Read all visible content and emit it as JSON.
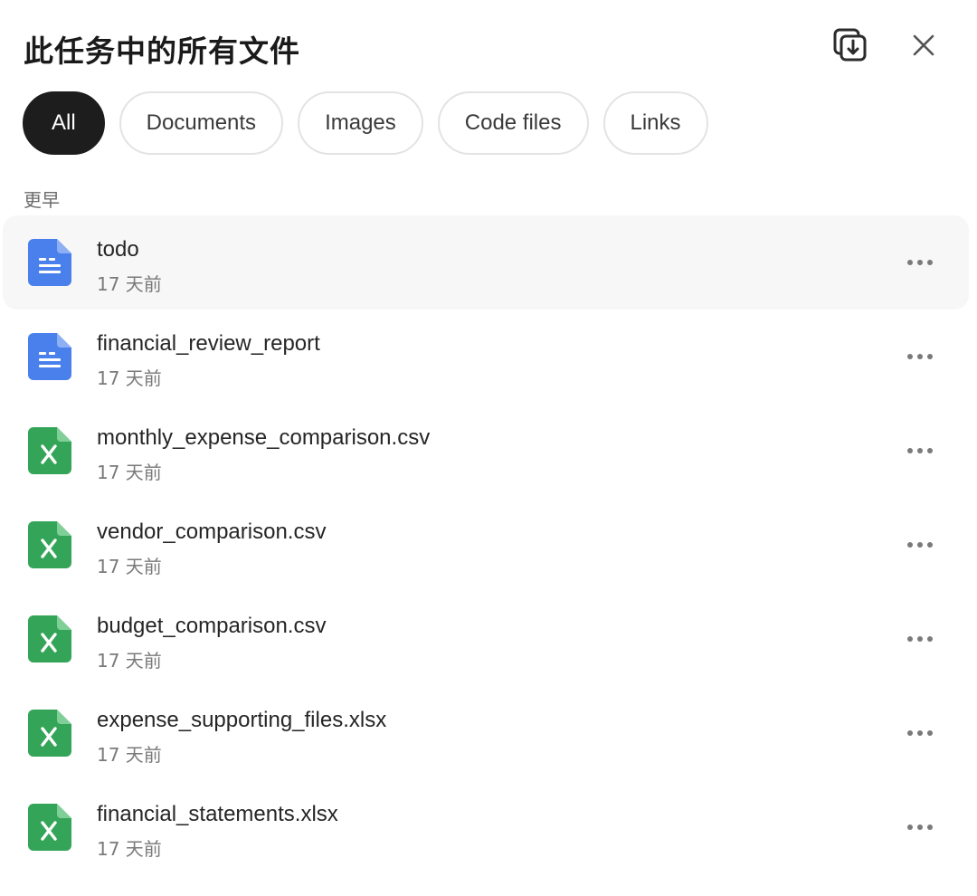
{
  "header": {
    "title": "此任务中的所有文件",
    "download_icon": "download-all-icon",
    "close_icon": "close-icon"
  },
  "tabs": [
    {
      "label": "All",
      "active": true
    },
    {
      "label": "Documents",
      "active": false
    },
    {
      "label": "Images",
      "active": false
    },
    {
      "label": "Code files",
      "active": false
    },
    {
      "label": "Links",
      "active": false
    }
  ],
  "section": {
    "label": "更早"
  },
  "files": [
    {
      "name": "todo",
      "time": "17 天前",
      "type": "doc",
      "icon": "doc-icon"
    },
    {
      "name": "financial_review_report",
      "time": "17 天前",
      "type": "doc",
      "icon": "doc-icon"
    },
    {
      "name": "monthly_expense_comparison.csv",
      "time": "17 天前",
      "type": "sheet",
      "icon": "spreadsheet-icon"
    },
    {
      "name": "vendor_comparison.csv",
      "time": "17 天前",
      "type": "sheet",
      "icon": "spreadsheet-icon"
    },
    {
      "name": "budget_comparison.csv",
      "time": "17 天前",
      "type": "sheet",
      "icon": "spreadsheet-icon"
    },
    {
      "name": "expense_supporting_files.xlsx",
      "time": "17 天前",
      "type": "sheet",
      "icon": "spreadsheet-icon"
    },
    {
      "name": "financial_statements.xlsx",
      "time": "17 天前",
      "type": "sheet",
      "icon": "spreadsheet-icon"
    }
  ],
  "colors": {
    "doc_blue": "#4a80ec",
    "sheet_green": "#34a558",
    "active_tab": "#1d1d1d",
    "row_highlight": "#f7f7f7"
  }
}
